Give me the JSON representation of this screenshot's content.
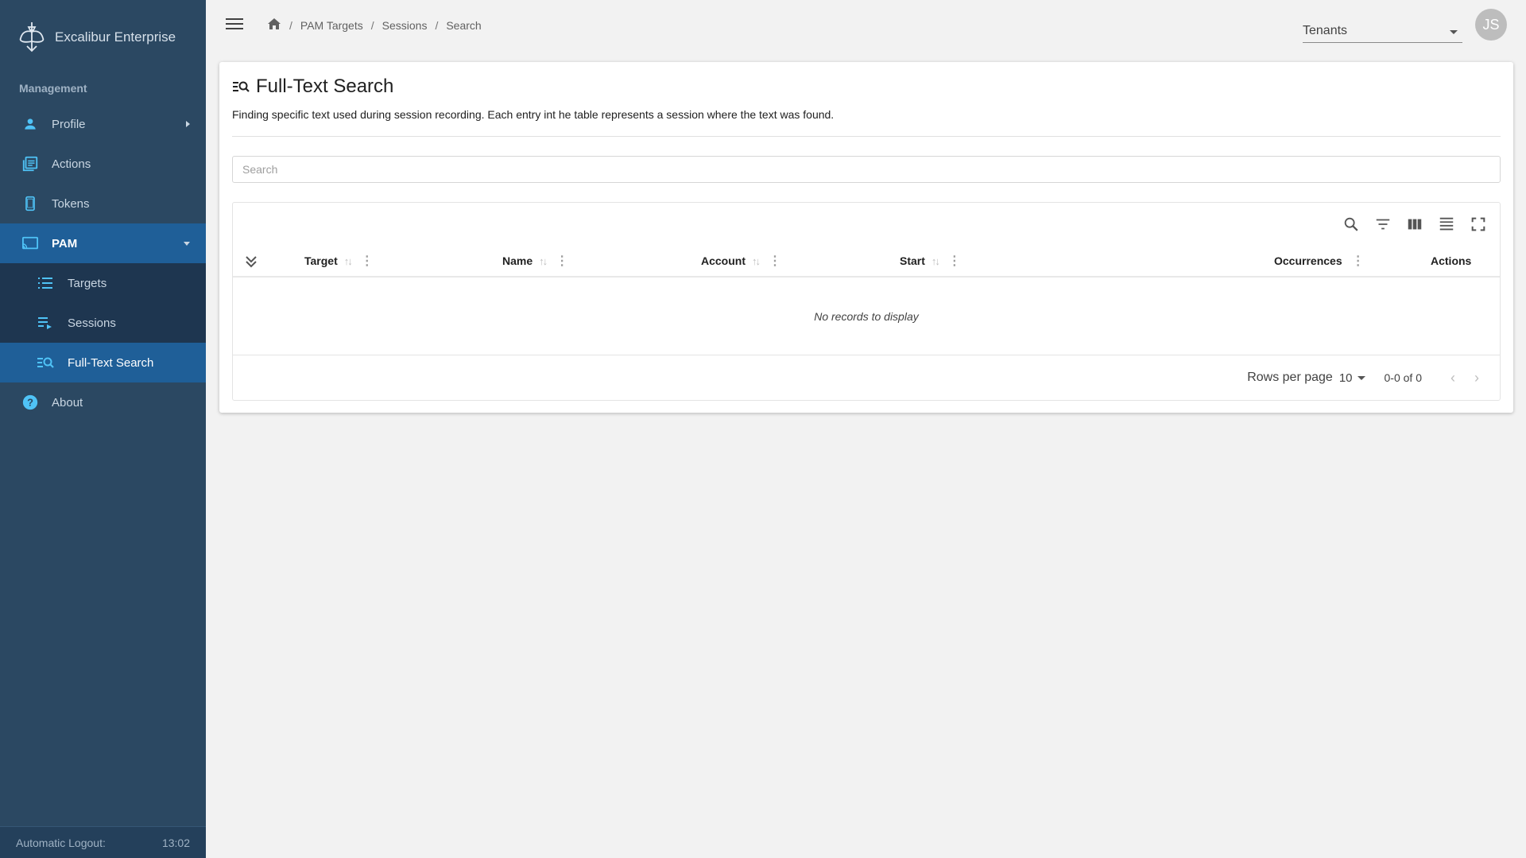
{
  "app": {
    "name": "Excalibur Enterprise",
    "logo_icon": "excalibur-logo-icon"
  },
  "sidebar": {
    "section_label": "Management",
    "items": [
      {
        "label": "Profile",
        "icon": "person-icon"
      },
      {
        "label": "Actions",
        "icon": "actions-list-icon"
      },
      {
        "label": "Tokens",
        "icon": "phone-token-icon"
      },
      {
        "label": "PAM",
        "icon": "cast-screen-icon"
      },
      {
        "label": "About",
        "icon": "help-circle-icon"
      }
    ],
    "pam_children": [
      {
        "label": "Targets",
        "icon": "list-icon"
      },
      {
        "label": "Sessions",
        "icon": "playlist-play-icon"
      },
      {
        "label": "Full-Text Search",
        "icon": "text-search-icon"
      }
    ],
    "footer": {
      "label": "Automatic Logout:",
      "value": "13:02"
    }
  },
  "topbar": {
    "breadcrumb": [
      "PAM Targets",
      "Sessions",
      "Search"
    ],
    "tenants_label": "Tenants",
    "avatar_initials": "JS"
  },
  "page": {
    "title": "Full-Text Search",
    "description": "Finding specific text used during session recording. Each entry int he table represents a session where the text was found.",
    "search_placeholder": "Search"
  },
  "table": {
    "columns": [
      "Target",
      "Name",
      "Account",
      "Start",
      "Occurrences",
      "Actions"
    ],
    "empty_message": "No records to display",
    "rows_per_page_label": "Rows per page",
    "rows_per_page": "10",
    "range": "0-0 of 0"
  },
  "colors": {
    "sidebar_bg": "#2b4862",
    "sidebar_active": "#1f5f98",
    "subnav_bg": "#1e3650",
    "icon_accent": "#4fc3f7"
  }
}
